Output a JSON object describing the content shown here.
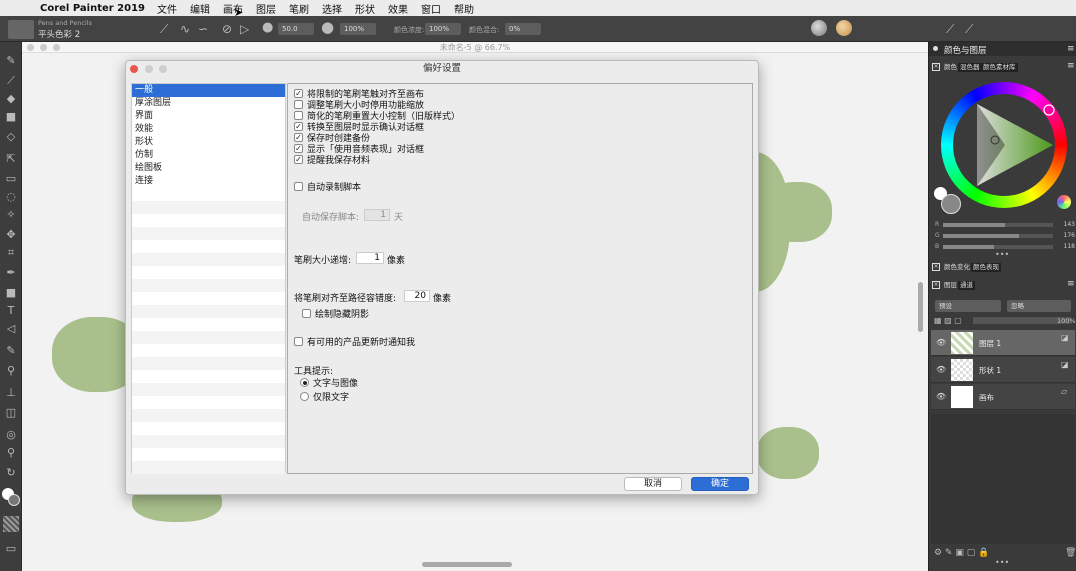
{
  "menubar": {
    "app_name": "Corel Painter 2019",
    "items": [
      "文件",
      "编辑",
      "画布",
      "图层",
      "笔刷",
      "选择",
      "形状",
      "效果",
      "窗口",
      "帮助"
    ]
  },
  "toolbar": {
    "brush_category": "Pens and Pencils",
    "brush_variant": "平头色彩 2",
    "size_value": "50.0",
    "opacity_value": "100%",
    "color_density_label": "颜色浓度:",
    "color_density_value": "100%",
    "color_mix_label": "颜色混合:",
    "color_mix_value": "0%"
  },
  "document": {
    "title": "未命名-5 @ 66.7%"
  },
  "dialog": {
    "title": "偏好设置",
    "categories": [
      "一般",
      "厚涂图层",
      "界面",
      "效能",
      "形状",
      "仿制",
      "绘图板",
      "连接"
    ],
    "selected_category": "一般",
    "options": [
      {
        "label": "将限制的笔刷笔触对齐至画布",
        "checked": true
      },
      {
        "label": "调整笔刷大小时停用功能缩放",
        "checked": false
      },
      {
        "label": "简化的笔刷重置大小控制（旧版样式）",
        "checked": false
      },
      {
        "label": "转换至图层时显示确认对话框",
        "checked": true
      },
      {
        "label": "保存时创建备份",
        "checked": true
      },
      {
        "label": "显示「使用音频表现」对话框",
        "checked": true
      },
      {
        "label": "提醒我保存材料",
        "checked": true
      }
    ],
    "auto_record_label": "自动录制脚本",
    "autosave_label": "自动保存脚本:",
    "autosave_value": "1",
    "autosave_unit": "天",
    "brush_step_label": "笔刷大小递增:",
    "brush_step_value": "1",
    "brush_step_unit": "像素",
    "path_tolerance_label": "将笔刷对齐至路径容错度:",
    "path_tolerance_value": "20",
    "path_tolerance_unit": "像素",
    "draw_hidden_shadow_label": "绘制隐藏阴影",
    "update_notify_label": "有可用的产品更新时通知我",
    "tooltip_label": "工具提示:",
    "tooltip_options": [
      {
        "label": "文字与图像",
        "selected": true
      },
      {
        "label": "仅限文字",
        "selected": false
      }
    ],
    "cancel_label": "取消",
    "ok_label": "确定"
  },
  "right_panel": {
    "header": "颜色与图层",
    "color_tabs": [
      "颜色",
      "混色器",
      "颜色素材库"
    ],
    "sliders": [
      {
        "label": "R",
        "value": "143",
        "fraction": 0.56
      },
      {
        "label": "G",
        "value": "176",
        "fraction": 0.69
      },
      {
        "label": "B",
        "value": "118",
        "fraction": 0.46
      }
    ],
    "variation_tabs": [
      "颜色变化",
      "颜色表现"
    ],
    "layer_tabs": [
      "图层",
      "通道"
    ],
    "composite_method": "预设",
    "composite_depth": "忽略",
    "opacity": "100%",
    "layers": [
      {
        "name": "图层 1",
        "selected": true
      },
      {
        "name": "形状 1",
        "selected": false
      },
      {
        "name": "画布",
        "selected": false
      }
    ]
  },
  "colors": {
    "accent": "#2c6ed5",
    "blob": "#a9c08c"
  }
}
